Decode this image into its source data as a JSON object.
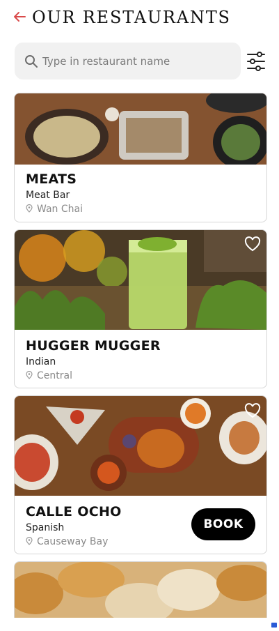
{
  "header": {
    "title": "OUR RESTAURANTS"
  },
  "search": {
    "placeholder": "Type in restaurant name"
  },
  "restaurants": [
    {
      "name": "MEATS",
      "cuisine": "Meat Bar",
      "location": "Wan Chai"
    },
    {
      "name": "HUGGER MUGGER",
      "cuisine": "Indian",
      "location": "Central"
    },
    {
      "name": "CALLE OCHO",
      "cuisine": "Spanish",
      "location": "Causeway Bay",
      "book_label": "BOOK"
    }
  ],
  "colors": {
    "accent": "#d94a4a",
    "book_button": "#000000"
  }
}
